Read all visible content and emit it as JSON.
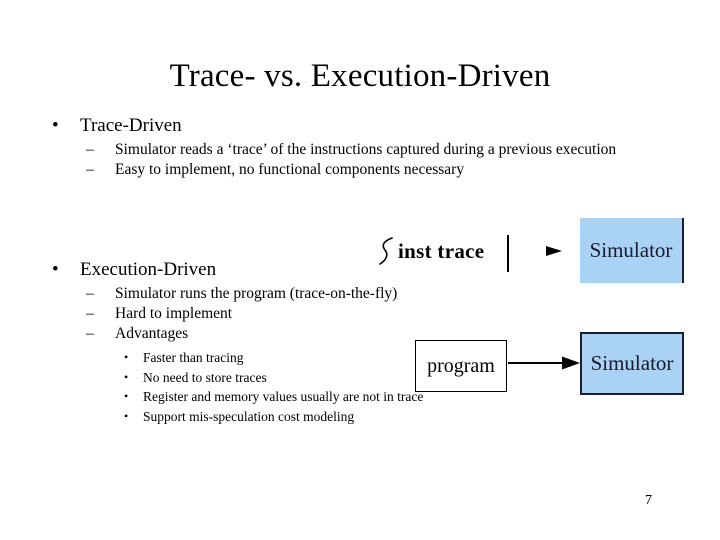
{
  "slide": {
    "title": "Trace- vs. Execution-Driven",
    "page_number": "7",
    "background_color": "#ffffff",
    "accent_color": "#a9d2f5"
  },
  "outline": {
    "section_one": {
      "bullet_glyph": "•",
      "heading": "Trace-Driven",
      "sub_bullet_glyph": "–",
      "sub_items": [
        "Simulator reads a ‘trace’ of the instructions captured during a previous execution",
        "Easy to implement, no functional components necessary"
      ]
    },
    "section_two": {
      "bullet_glyph": "•",
      "heading": "Execution-Driven",
      "sub_bullet_glyph": "–",
      "sub_items": [
        "Simulator runs the program (trace-on-the-fly)",
        "Hard to implement",
        "Advantages"
      ],
      "sub_sub_bullet_glyph": "•",
      "sub_sub_items": [
        "Faster than tracing",
        "No need to store traces",
        "Register and memory values usually are not in trace",
        "Support mis-speculation cost modeling"
      ]
    }
  },
  "diagrams": {
    "trace_driven": {
      "trace_label": "inst trace",
      "simulator_label": "Simulator"
    },
    "execution_driven": {
      "program_label": "program",
      "simulator_label": "Simulator"
    }
  }
}
